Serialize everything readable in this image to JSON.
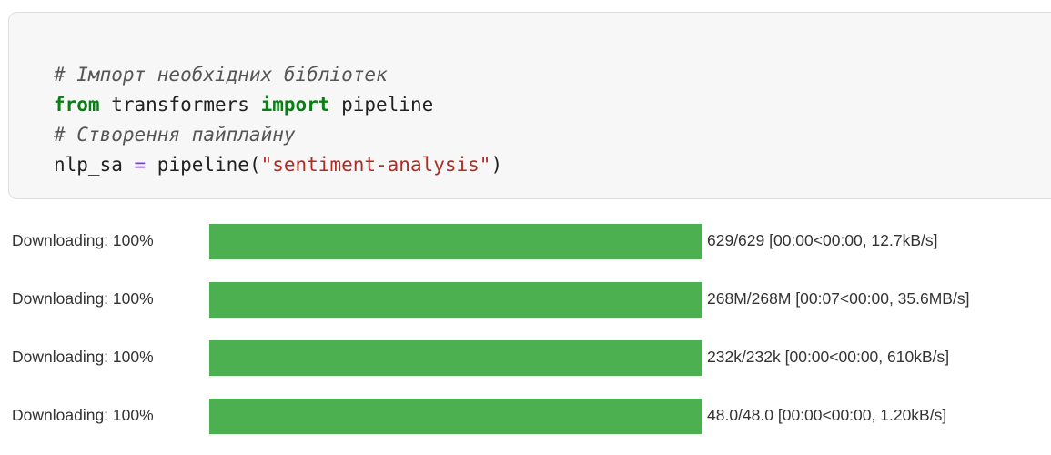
{
  "code_cell": {
    "lines": [
      {
        "type": "comment",
        "text": "# Імпорт необхідних бібліотек"
      },
      {
        "type": "code",
        "kw1": "from",
        "mod": " transformers ",
        "kw2": "import",
        "rest": " pipeline"
      },
      {
        "type": "comment",
        "text": "# Створення пайплайну"
      },
      {
        "type": "code",
        "var": "nlp_sa",
        "op": " = ",
        "fn": "pipeline(",
        "str": "\"sentiment-analysis\"",
        "close": ")"
      }
    ]
  },
  "output": {
    "progress_color": "#4caf50",
    "downloads": [
      {
        "label": "Downloading: 100%",
        "progress": 1.0,
        "status": "629/629 [00:00<00:00, 12.7kB/s]"
      },
      {
        "label": "Downloading: 100%",
        "progress": 1.0,
        "status": "268M/268M [00:07<00:00, 35.6MB/s]"
      },
      {
        "label": "Downloading: 100%",
        "progress": 1.0,
        "status": "232k/232k [00:00<00:00, 610kB/s]"
      },
      {
        "label": "Downloading: 100%",
        "progress": 1.0,
        "status": "48.0/48.0 [00:00<00:00, 1.20kB/s]"
      }
    ]
  }
}
